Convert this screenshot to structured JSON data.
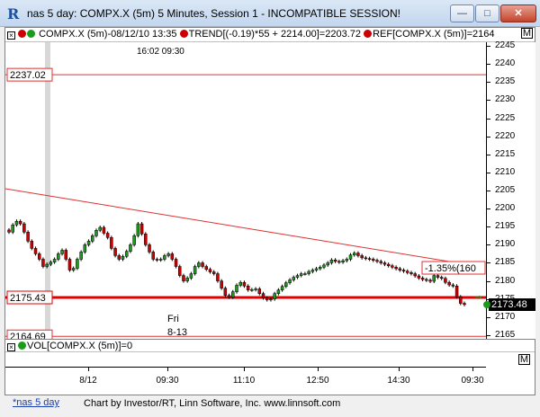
{
  "window": {
    "title": "nas 5 day: COMPX.X (5m) 5 Minutes, Session 1 - INCOMPATIBLE SESSION!",
    "min_glyph": "—",
    "max_glyph": "□",
    "close_glyph": "✕",
    "app_glyph": "R"
  },
  "legend": {
    "main": "COMPX.X (5m)-08/12/10 13:35",
    "trend": "TREND[(-0.19)*55 + 2214.00]=2203.72",
    "ref": "REF[COMPX.X (5m)]=2164",
    "m_label": "M",
    "dot1_color": "#cc0000",
    "dot2_color": "#1a9c1a",
    "trend_color": "#cc0000",
    "ref_color": "#cc0000"
  },
  "header_times": "16:02  09:30",
  "chart_data": {
    "type": "candlestick",
    "symbol": "COMPX.X (5m)",
    "ylim": [
      2164,
      2246
    ],
    "y_ticks": [
      2165,
      2170,
      2175,
      2180,
      2185,
      2190,
      2195,
      2200,
      2205,
      2210,
      2215,
      2220,
      2225,
      2230,
      2235,
      2240,
      2245
    ],
    "x_ticks": [
      "8/12",
      "09:30",
      "11:10",
      "12:50",
      "14:30",
      "09:30"
    ],
    "ref_lines": [
      {
        "label": "2237.02",
        "value": 2237.02,
        "color": "#e03030"
      },
      {
        "label": "2175.43",
        "value": 2175.43,
        "color": "#e00000"
      },
      {
        "label": "2164.69",
        "value": 2164.69,
        "color": "#e03030"
      }
    ],
    "last_price_label": "2173.48",
    "trend_label": "-1.35%(160",
    "date_annotation_day": "Fri",
    "date_annotation_date": "8-13",
    "up_color": "#1a9c1a",
    "down_color": "#cc0000",
    "closes": [
      2193.5,
      2195.5,
      2196.5,
      2195.8,
      2193.5,
      2191,
      2189,
      2187.5,
      2186,
      2184,
      2184.6,
      2185.2,
      2186,
      2187.5,
      2188.5,
      2186,
      2183,
      2183.5,
      2186,
      2188,
      2190,
      2191,
      2192.5,
      2194,
      2194.8,
      2193.2,
      2192,
      2189,
      2187,
      2186,
      2186.8,
      2188.2,
      2190,
      2192.5,
      2195.8,
      2193,
      2190,
      2188,
      2186,
      2185.8,
      2186,
      2187,
      2187.5,
      2186,
      2184,
      2181.5,
      2180,
      2180.8,
      2182,
      2184,
      2185,
      2184,
      2183.2,
      2182.5,
      2182,
      2180,
      2178,
      2176,
      2175.5,
      2177,
      2178.8,
      2179.6,
      2178.6,
      2177.5,
      2177.6,
      2177.8,
      2176.5,
      2175.3,
      2174.8,
      2175,
      2176.5,
      2177.5,
      2178.5,
      2179.5,
      2180.3,
      2181,
      2181.5,
      2182,
      2182,
      2182.6,
      2183,
      2183.4,
      2183.8,
      2184.4,
      2185,
      2185.8,
      2185.4,
      2185.2,
      2185.6,
      2186,
      2187.2,
      2187.7,
      2187,
      2186.4,
      2186.2,
      2186,
      2185.7,
      2185.4,
      2185,
      2184.6,
      2184.2,
      2183.8,
      2183.4,
      2183,
      2182.7,
      2182.3,
      2182,
      2181.4,
      2180.8,
      2180.4,
      2180.2,
      2179.9,
      2181.5,
      2181,
      2180.7,
      2179.6,
      2178.9,
      2178.6,
      2175.6,
      2173.8,
      2173.48
    ]
  },
  "volume": {
    "label": "VOL[COMPX.X (5m)]=0",
    "m_label": "M"
  },
  "status": {
    "tab": "*nas 5 day",
    "credit": "Chart by Investor/RT, Linn Software, Inc. www.linnsoft.com"
  }
}
